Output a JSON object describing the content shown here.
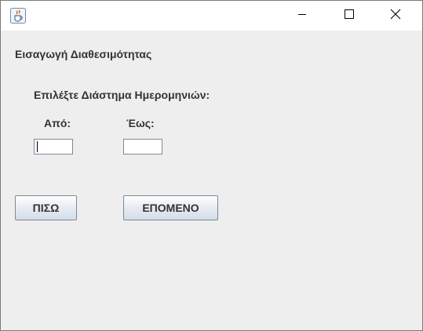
{
  "titlebar": {
    "app_icon": "java-cup-icon",
    "minimize_icon": "minimize-icon",
    "maximize_icon": "maximize-icon",
    "close_icon": "close-icon"
  },
  "form": {
    "heading": "Εισαγωγή Διαθεσιμότητας",
    "range_label": "Επιλέξτε Διάστημα Ημερομηνιών:",
    "from_label": "Από:",
    "to_label": "Έως:",
    "from_value": "",
    "to_value": ""
  },
  "buttons": {
    "back_label": "ΠΙΣΩ",
    "next_label": "ΕΠΟΜΕΝΟ"
  }
}
